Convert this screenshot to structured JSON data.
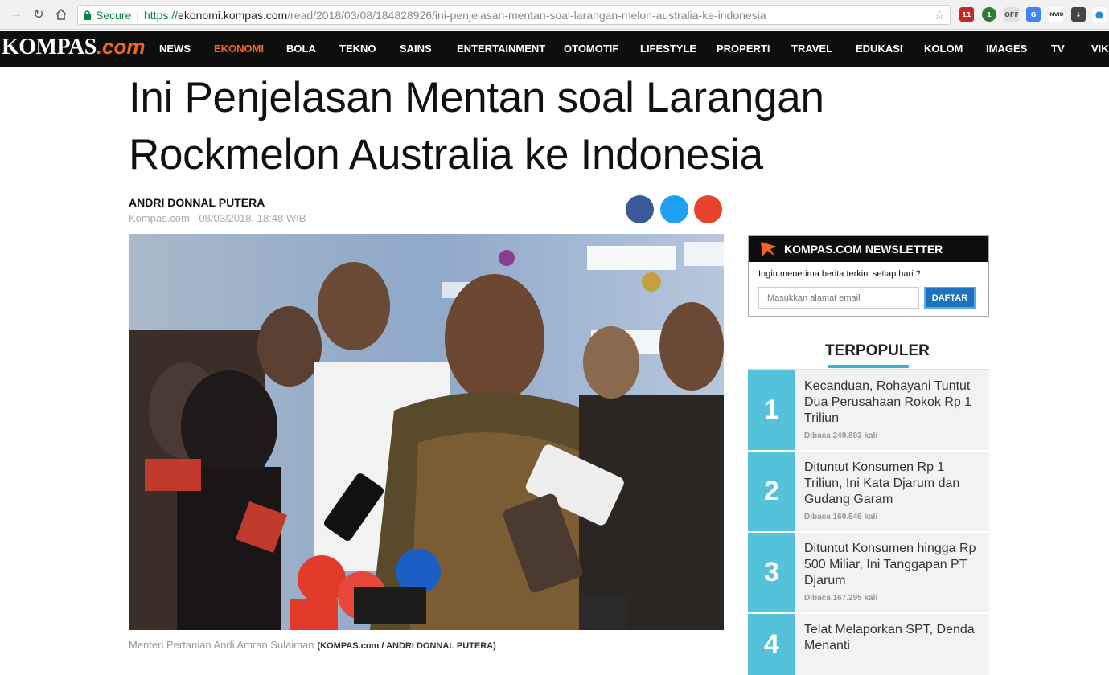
{
  "browser": {
    "secure_label": "Secure",
    "url_scheme": "https://",
    "url_host": "ekonomi.kompas.com",
    "url_path": "/read/2018/03/08/184828926/ini-penjelasan-mentan-soal-larangan-melon-australia-ke-indonesia",
    "extensions": [
      "11",
      "1",
      "OFF",
      "G",
      "INVID",
      "↓",
      "●"
    ]
  },
  "site": {
    "logo_main": "KOMPAS",
    "logo_suffix": ".com",
    "menu": [
      "NEWS",
      "EKONOMI",
      "BOLA",
      "TEKNO",
      "SAINS",
      "ENTERTAINMENT",
      "OTOMOTIF",
      "LIFESTYLE",
      "PROPERTI",
      "TRAVEL",
      "EDUKASI",
      "KOLOM",
      "IMAGES",
      "TV",
      "VIK"
    ],
    "active_menu": "EKONOMI"
  },
  "article": {
    "title_line1": "Ini Penjelasan Mentan soal Larangan",
    "title_line2": "Rockmelon Australia ke Indonesia",
    "author": "ANDRI DONNAL PUTERA",
    "dateline": "Kompas.com - 08/03/2018, 18:48 WIB",
    "share_colors": [
      "#3b5998",
      "#1da1f2",
      "#e8432c"
    ],
    "caption": "Menteri Pertanian Andi Amran Sulaiman",
    "credit": "(KOMPAS.com / ANDRI DONNAL PUTERA)"
  },
  "newsletter": {
    "title": "KOMPAS.COM NEWSLETTER",
    "question": "Ingin menerima berita terkini setiap hari ?",
    "placeholder": "Masukkan alamat email",
    "button": "DAFTAR"
  },
  "popular": {
    "heading": "TERPOPULER",
    "items": [
      {
        "num": "1",
        "title": "Kecanduan, Rohayani Tuntut Dua Perusahaan Rokok Rp 1 Triliun",
        "count": "Dibaca 249.893 kali"
      },
      {
        "num": "2",
        "title": "Dituntut Konsumen Rp 1 Triliun, Ini Kata Djarum dan Gudang Garam",
        "count": "Dibaca 169.549 kali"
      },
      {
        "num": "3",
        "title": "Dituntut Konsumen hingga Rp 500 Miliar, Ini Tanggapan PT Djarum",
        "count": "Dibaca 167.295 kali"
      },
      {
        "num": "4",
        "title": "Telat Melaporkan SPT, Denda Menanti",
        "count": ""
      }
    ]
  }
}
